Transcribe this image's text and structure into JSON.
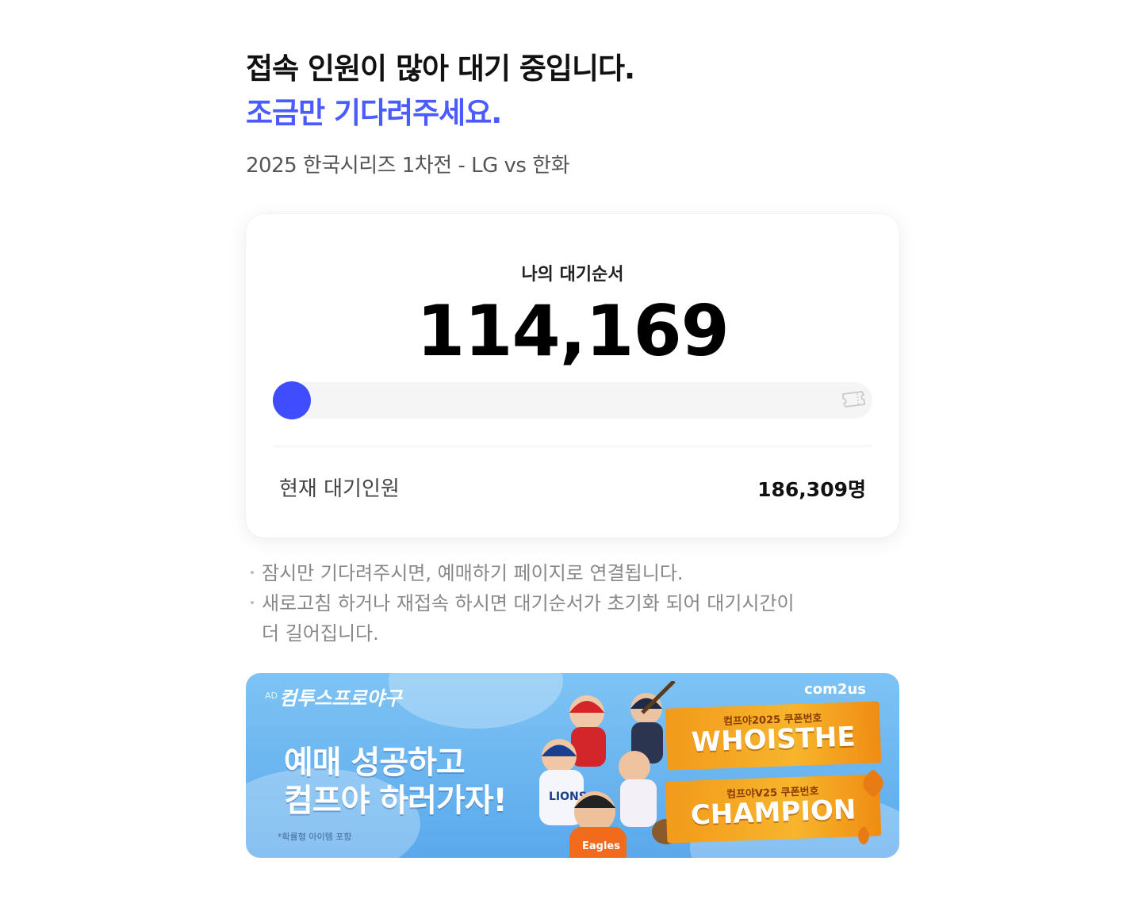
{
  "header": {
    "title_line1": "접속 인원이 많아 대기 중입니다.",
    "title_line2": "조금만 기다려주세요.",
    "event": "2025 한국시리즈 1차전 - LG vs 한화"
  },
  "queue_card": {
    "label": "나의 대기순서",
    "position": "114,169",
    "progress_fraction": 0.0,
    "progress_icon": "ticket-icon",
    "current_waiting_label": "현재 대기인원",
    "current_waiting_value": "186,309명"
  },
  "notes": [
    "잠시만 기다려주시면, 예매하기 페이지로 연결됩니다.",
    "새로고침 하거나 재접속 하시면 대기순서가 초기화 되어 대기시간이",
    "더 길어집니다."
  ],
  "banner": {
    "ad_tag": "AD",
    "brand": "컴투스프로야구",
    "logo": "com2us",
    "headline_line1": "예매 성공하고",
    "headline_line2": "컴프야 하러가자!",
    "fine_print": "*확률형 아이템 포함",
    "coupon1_caption": "컴프야2025 쿠폰번호",
    "coupon1_code": "WHOISTHE",
    "coupon2_caption": "컴프야V25 쿠폰번호",
    "coupon2_code": "CHAMPION"
  },
  "colors": {
    "accent": "#3f4dff",
    "title_accent": "#4a5cff",
    "banner_sky": "#5aa9ec",
    "ribbon": "#f5a623"
  }
}
